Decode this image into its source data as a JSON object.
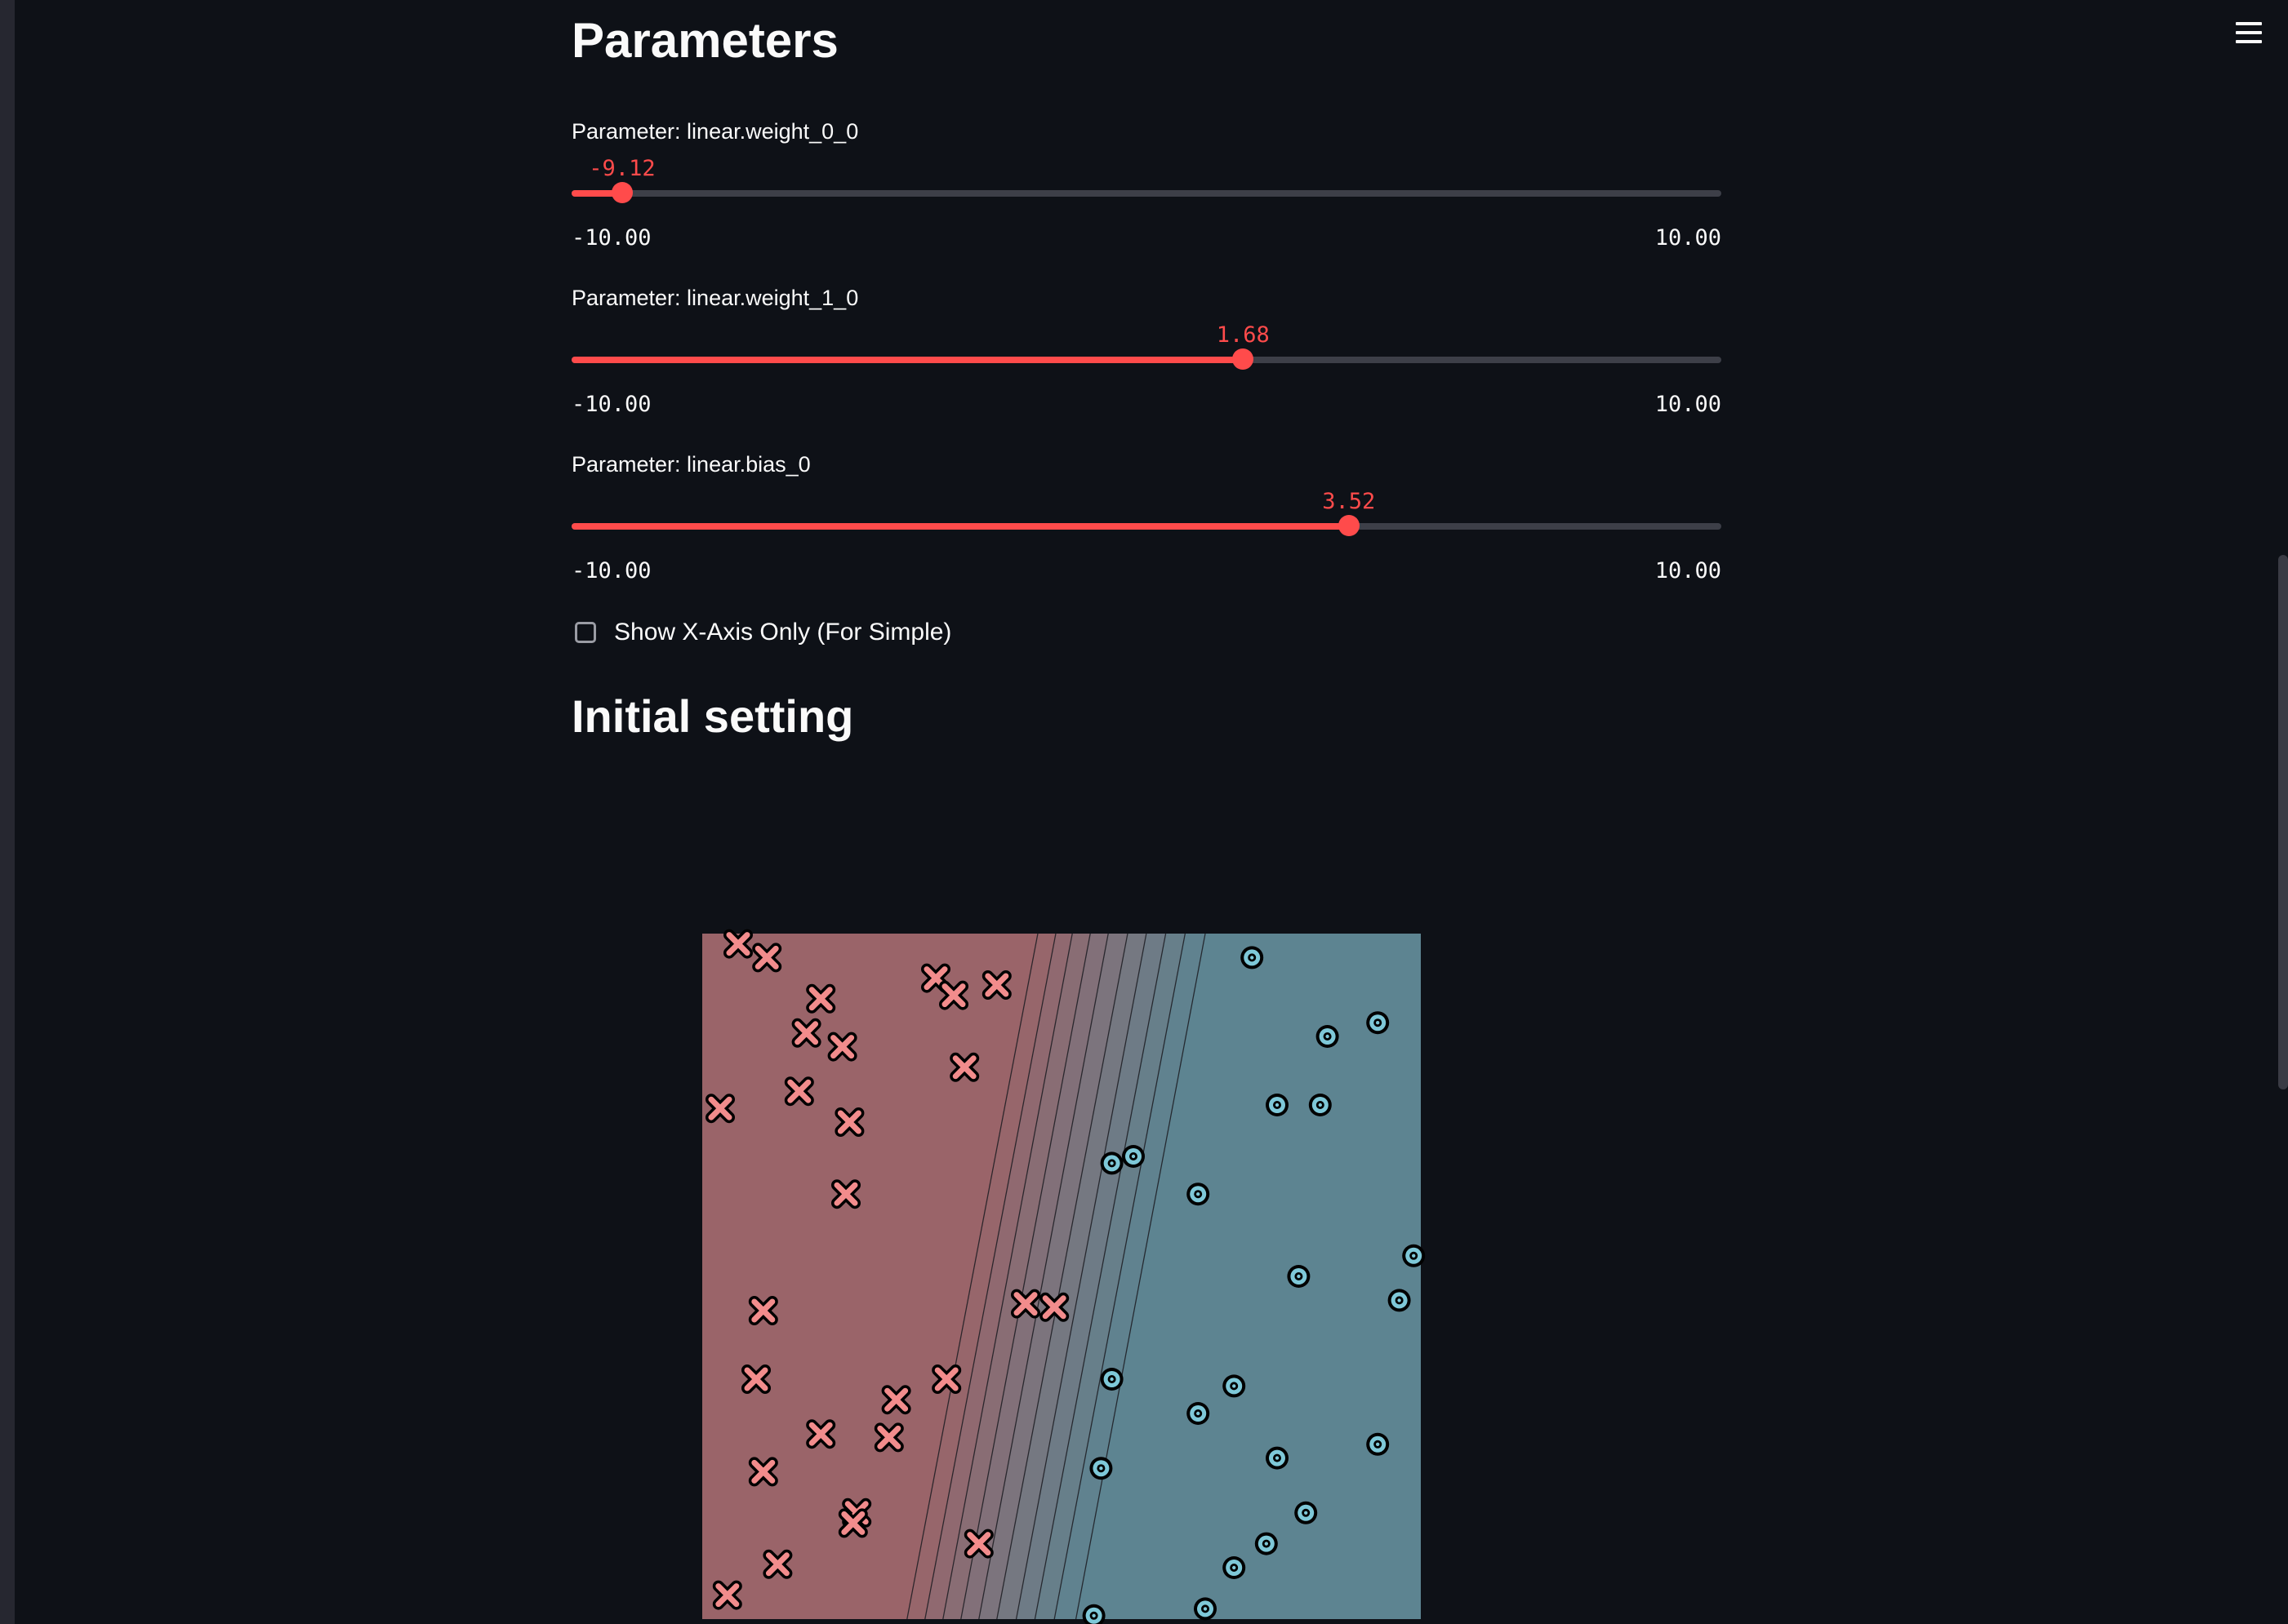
{
  "app": {
    "menu_icon": "hamburger-menu-icon"
  },
  "header": {
    "partial_title": "Parameters"
  },
  "sliders": [
    {
      "label": "Parameter: linear.weight_0_0",
      "value": -9.12,
      "value_text": "-9.12",
      "min_text": "-10.00",
      "max_text": "10.00",
      "min": -10,
      "max": 10
    },
    {
      "label": "Parameter: linear.weight_1_0",
      "value": 1.68,
      "value_text": "1.68",
      "min_text": "-10.00",
      "max_text": "10.00",
      "min": -10,
      "max": 10
    },
    {
      "label": "Parameter: linear.bias_0",
      "value": 3.52,
      "value_text": "3.52",
      "min_text": "-10.00",
      "max_text": "10.00",
      "min": -10,
      "max": 10
    }
  ],
  "checkbox": {
    "label": "Show X-Axis Only (For Simple)",
    "checked": false
  },
  "section": {
    "title": "Initial setting"
  },
  "colors": {
    "accent": "#ff4b4b",
    "background": "#0e1117",
    "class0_region": "#9a6469",
    "class1_region": "#5d8491",
    "class0_marker": "#f28c8c",
    "class1_marker": "#7ec8d8"
  },
  "chart_data": {
    "type": "scatter",
    "title": "",
    "xlabel": "",
    "ylabel": "",
    "xlim": [
      0,
      1
    ],
    "ylim": [
      0,
      1
    ],
    "grid": false,
    "decision_boundary": {
      "contour_levels": 10,
      "line_x_at_top": [
        0.467,
        0.492,
        0.515,
        0.54,
        0.565,
        0.592,
        0.618,
        0.645,
        0.672,
        0.7
      ],
      "line_x_at_bottom": [
        0.285,
        0.31,
        0.335,
        0.36,
        0.385,
        0.41,
        0.437,
        0.463,
        0.49,
        0.52
      ]
    },
    "series": [
      {
        "marker": "x",
        "points": [
          [
            0.05,
            0.985
          ],
          [
            0.09,
            0.965
          ],
          [
            0.165,
            0.905
          ],
          [
            0.145,
            0.855
          ],
          [
            0.195,
            0.835
          ],
          [
            0.135,
            0.77
          ],
          [
            0.025,
            0.745
          ],
          [
            0.205,
            0.725
          ],
          [
            0.2,
            0.62
          ],
          [
            0.325,
            0.935
          ],
          [
            0.35,
            0.91
          ],
          [
            0.41,
            0.925
          ],
          [
            0.365,
            0.805
          ],
          [
            0.085,
            0.45
          ],
          [
            0.45,
            0.46
          ],
          [
            0.49,
            0.455
          ],
          [
            0.075,
            0.35
          ],
          [
            0.34,
            0.35
          ],
          [
            0.27,
            0.32
          ],
          [
            0.165,
            0.27
          ],
          [
            0.26,
            0.265
          ],
          [
            0.085,
            0.215
          ],
          [
            0.215,
            0.155
          ],
          [
            0.21,
            0.14
          ],
          [
            0.385,
            0.11
          ],
          [
            0.105,
            0.08
          ],
          [
            0.035,
            0.035
          ]
        ]
      },
      {
        "marker": "o",
        "points": [
          [
            0.765,
            0.965
          ],
          [
            0.87,
            0.85
          ],
          [
            0.94,
            0.87
          ],
          [
            0.8,
            0.75
          ],
          [
            0.86,
            0.75
          ],
          [
            0.57,
            0.665
          ],
          [
            0.6,
            0.675
          ],
          [
            0.69,
            0.62
          ],
          [
            0.99,
            0.53
          ],
          [
            0.83,
            0.5
          ],
          [
            0.97,
            0.465
          ],
          [
            0.57,
            0.35
          ],
          [
            0.74,
            0.34
          ],
          [
            0.69,
            0.3
          ],
          [
            0.8,
            0.235
          ],
          [
            0.94,
            0.255
          ],
          [
            0.555,
            0.22
          ],
          [
            0.84,
            0.155
          ],
          [
            0.785,
            0.11
          ],
          [
            0.74,
            0.075
          ],
          [
            0.7,
            0.015
          ],
          [
            0.545,
            0.005
          ]
        ]
      }
    ]
  }
}
